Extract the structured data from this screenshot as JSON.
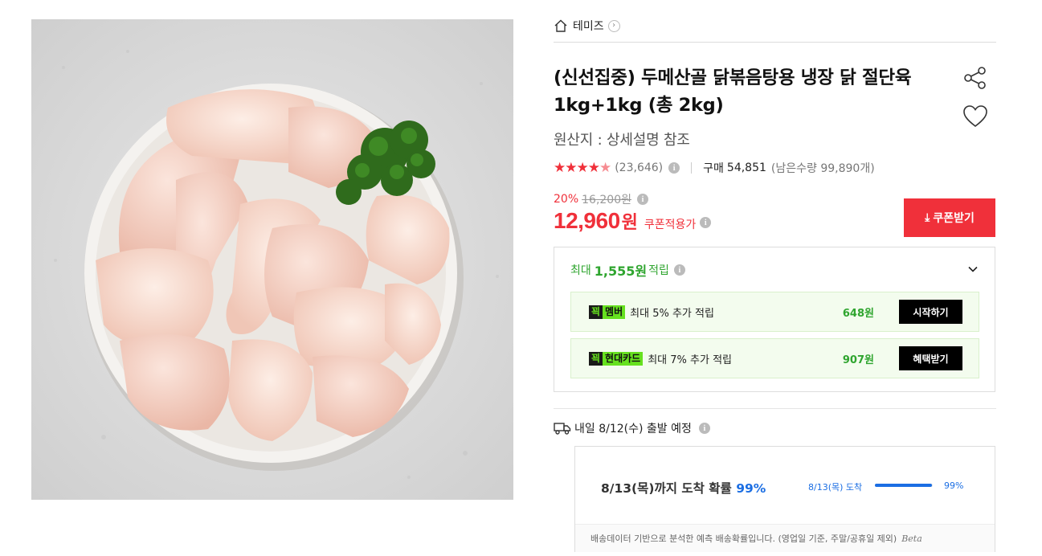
{
  "seller": {
    "name": "테미즈",
    "home_icon": "home-icon",
    "chevron_icon": "chevron-right-icon"
  },
  "product": {
    "title": "(신선집중) 두메산골 닭볶음탕용 냉장 닭 절단육 1kg+1kg (총 2kg)",
    "origin": "원산지 : 상세설명 참조",
    "image_alt": "raw chicken pieces in a white bowl with parsley"
  },
  "rating": {
    "stars": 4.5,
    "review_count": "(23,646)",
    "purchase_label": "구매",
    "purchase_count": "54,851",
    "remaining": "(남은수량 99,890개)"
  },
  "price": {
    "discount_rate": "20%",
    "original_price": "16,200원",
    "sale_price": "12,960",
    "currency": "원",
    "coupon_applied_label": "쿠폰적용가"
  },
  "coupon_button": {
    "label": "쿠폰받기",
    "icon": "download-icon"
  },
  "points": {
    "prefix": "최대",
    "amount": "1,555원",
    "suffix": "적립",
    "benefits": [
      {
        "badge_k": "꾁",
        "badge_name": "멤버",
        "desc": "최대 5% 추가 적립",
        "amount": "648원",
        "action": "시작하기"
      },
      {
        "badge_k": "꾁",
        "badge_name": "현대카드",
        "desc": "최대 7% 추가 적립",
        "amount": "907원",
        "action": "혜택받기"
      }
    ]
  },
  "shipping": {
    "departure": "내일 8/12(수) 출발 예정",
    "arrival_text": "8/13(목)까지 도착 확률",
    "arrival_pct": "99%",
    "bar_label": "8/13(목) 도착",
    "bar_pct_label": "99%",
    "bar_fill": 0.99,
    "note": "배송데이터 기반으로 분석한 예측 배송확률입니다. (영업일 기준, 주말/공휴일 제외)",
    "beta": "Beta"
  },
  "colors": {
    "accent_red": "#f0303a",
    "points_green": "#2fa52f",
    "badge_green": "#66e11f",
    "ship_blue": "#1b6ee3"
  }
}
